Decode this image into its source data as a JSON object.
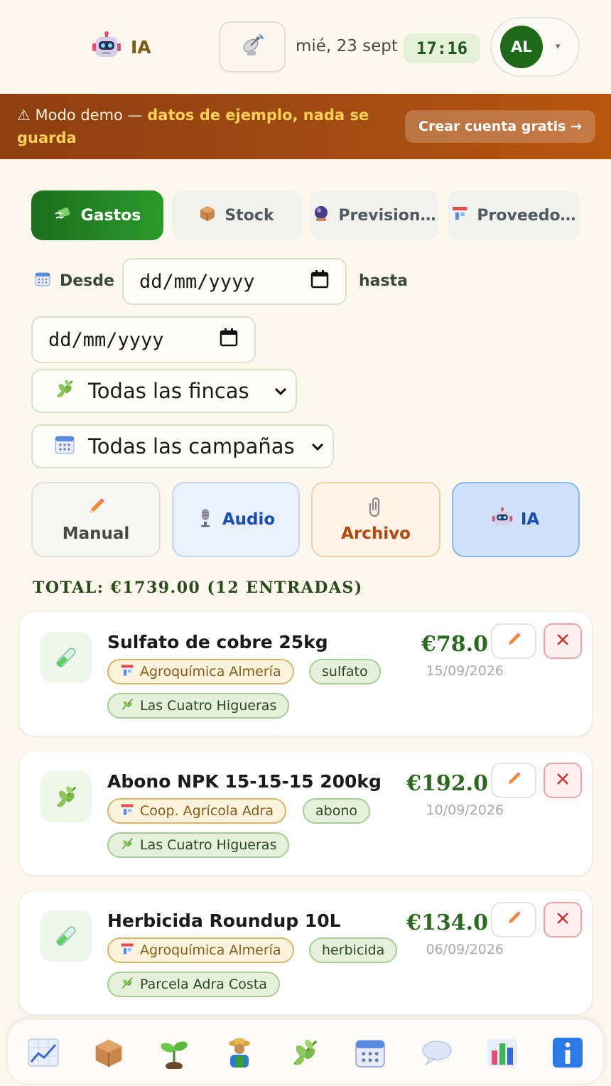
{
  "header": {
    "ia_label": "IA",
    "date": "mié, 23 sept",
    "time": "17:16",
    "user_initials": "AL",
    "caret": "▾"
  },
  "banner": {
    "prefix": "⚠ Modo demo — ",
    "highlight": "datos de ejemplo, nada se guarda",
    "cta": "Crear cuenta gratis →"
  },
  "tabs": [
    {
      "label": "Gastos",
      "active": true
    },
    {
      "label": "Stock",
      "active": false
    },
    {
      "label": "Prevision…",
      "active": false
    },
    {
      "label": "Proveedo…",
      "active": false
    }
  ],
  "filters": {
    "desde_label": "Desde",
    "hasta_label": "hasta",
    "date_placeholder": "dd/mm/yyyy",
    "fincas_select": "Todas las fincas",
    "campanas_select": "Todas las campañas"
  },
  "input_methods": {
    "manual": "Manual",
    "audio": "Audio",
    "archivo": "Archivo",
    "ia": "IA"
  },
  "summary": {
    "total_text": "TOTAL: €1739.00 (12 ENTRADAS)"
  },
  "expenses": [
    {
      "title": "Sulfato de cobre 25kg",
      "supplier": "Agroquímica Almería",
      "tag": "sulfato",
      "farm": "Las Cuatro Higueras",
      "amount": "€78.0",
      "date": "15/09/2026",
      "icon": "test-tube-icon"
    },
    {
      "title": "Abono NPK 15-15-15 200kg",
      "supplier": "Coop. Agrícola Adra",
      "tag": "abono",
      "farm": "Las Cuatro Higueras",
      "amount": "€192.0",
      "date": "10/09/2026",
      "icon": "herb-icon"
    },
    {
      "title": "Herbicida Roundup 10L",
      "supplier": "Agroquímica Almería",
      "tag": "herbicida",
      "farm": "Parcela Adra Costa",
      "amount": "€134.0",
      "date": "06/09/2026",
      "icon": "test-tube-icon"
    }
  ],
  "bottom_nav": [
    "chart-increasing-icon",
    "package-icon",
    "seedling-icon",
    "farmer-icon",
    "herb-icon",
    "calendar-icon",
    "speech-bubble-icon",
    "bar-chart-icon",
    "info-icon"
  ],
  "colors": {
    "accent_green": "#1f6a1a",
    "banner_bg": "#a44c12",
    "banner_highlight": "#fcd15a",
    "delete_red": "#d32f2f"
  }
}
